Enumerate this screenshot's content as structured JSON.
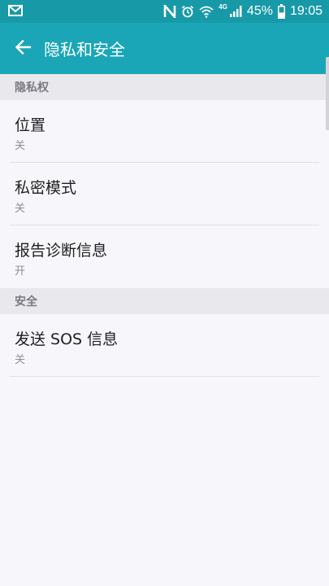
{
  "status_bar": {
    "battery_percent": "45%",
    "time": "19:05",
    "network_label": "4G",
    "icons": [
      "email-icon",
      "nfc-icon",
      "alarm-icon",
      "wifi-icon",
      "signal-icon",
      "battery-icon"
    ],
    "battery_level": 0.45
  },
  "app_bar": {
    "title": "隐私和安全",
    "back_icon": "back-arrow-icon",
    "color": "#1aa6b7",
    "status_color": "#1799a8"
  },
  "sections": [
    {
      "header": "隐私权",
      "items": [
        {
          "title": "位置",
          "value": "关"
        },
        {
          "title": "私密模式",
          "value": "关"
        },
        {
          "title": "报告诊断信息",
          "value": "开"
        }
      ]
    },
    {
      "header": "安全",
      "items": [
        {
          "title": "发送 SOS 信息",
          "value": "关"
        }
      ]
    }
  ]
}
